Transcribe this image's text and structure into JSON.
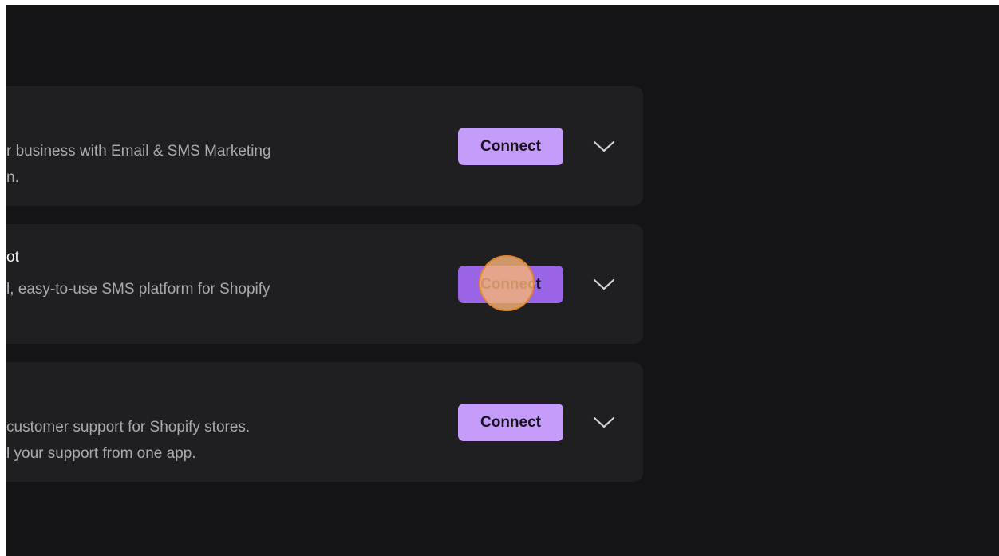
{
  "integrations": [
    {
      "title": "",
      "description": [
        "r business with Email & SMS Marketing",
        "n."
      ],
      "connect_label": "Connect"
    },
    {
      "title": "ot",
      "description": [
        "l, easy-to-use SMS platform for Shopify"
      ],
      "connect_label": "Connect"
    },
    {
      "title": "",
      "description": [
        "customer support for Shopify stores.",
        "l your support from one app."
      ],
      "connect_label": "Connect"
    }
  ],
  "icons": {
    "expand": "chevron-down-icon"
  },
  "colors": {
    "page_background": "#141416",
    "card_background": "#1f1f22",
    "button_primary": "#c59cfa",
    "button_pressed": "#9a64e6",
    "click_indicator": "#f5b278"
  }
}
